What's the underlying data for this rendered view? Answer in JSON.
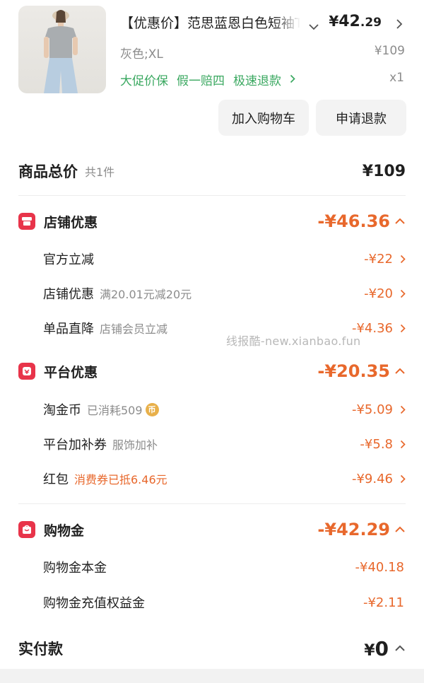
{
  "product": {
    "title": "【优惠价】范思蓝恩白色短袖T恤",
    "price_yen": "¥",
    "price_int": "42",
    "price_dec": ".29",
    "variant": "灰色;XL",
    "original_price": "¥109",
    "tags": [
      "大促价保",
      "假一赔四",
      "极速退款"
    ],
    "quantity": "x1",
    "add_to_cart_label": "加入购物车",
    "refund_label": "申请退款"
  },
  "summary": {
    "title": "商品总价",
    "count": "共1件",
    "amount": "¥109"
  },
  "store_discount": {
    "title": "店铺优惠",
    "amount": "-¥46.36",
    "items": [
      {
        "label": "官方立减",
        "sub": "",
        "amount": "-¥22"
      },
      {
        "label": "店铺优惠",
        "sub": "满20.01元减20元",
        "amount": "-¥20"
      },
      {
        "label": "单品直降",
        "sub": "店铺会员立减",
        "amount": "-¥4.36"
      }
    ]
  },
  "platform_discount": {
    "title": "平台优惠",
    "amount": "-¥20.35",
    "items": [
      {
        "label": "淘金币",
        "sub": "已消耗509",
        "amount": "-¥5.09"
      },
      {
        "label": "平台加补券",
        "sub": "服饰加补",
        "amount": "-¥5.8"
      },
      {
        "label": "红包",
        "sub": "消费券已抵6.46元",
        "amount": "-¥9.46"
      }
    ]
  },
  "shopping_gold": {
    "title": "购物金",
    "amount": "-¥42.29",
    "items": [
      {
        "label": "购物金本金",
        "amount": "-¥40.18"
      },
      {
        "label": "购物金充值权益金",
        "amount": "-¥2.11"
      }
    ]
  },
  "payment": {
    "title": "实付款",
    "yen": "¥",
    "amount": "0"
  },
  "watermark": "线报酷-new.xianbao.fun",
  "coin_glyph": "币",
  "colors": {
    "accent_orange": "#e8682c",
    "tag_green": "#3aa860",
    "section_icon_red": "#e8344a"
  },
  "icons": [
    "shirt-thumbnail",
    "chevron-down-icon",
    "chevron-right-icon",
    "chevron-up-icon",
    "store-icon",
    "platform-icon",
    "wallet-icon",
    "coin-icon"
  ]
}
